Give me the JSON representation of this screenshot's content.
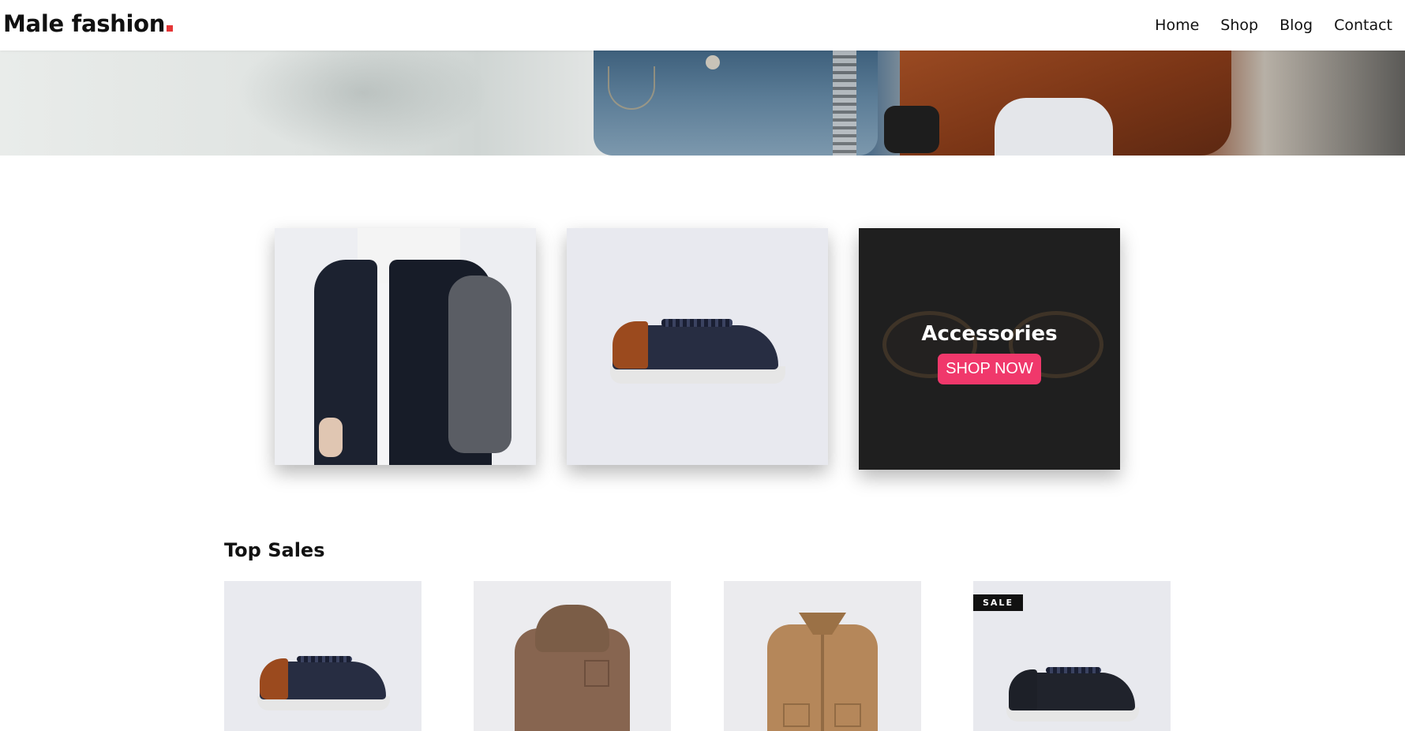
{
  "header": {
    "logo_text": "Male fashion",
    "nav": [
      {
        "label": "Home"
      },
      {
        "label": "Shop"
      },
      {
        "label": "Blog"
      },
      {
        "label": "Contact"
      }
    ]
  },
  "banners": [
    {
      "image": "jacket-photo"
    },
    {
      "image": "sneaker-photo"
    },
    {
      "title": "Accessories",
      "button_label": "SHOP NOW",
      "image": "sunglasses-photo"
    }
  ],
  "top_sales": {
    "title": "Top Sales",
    "products": [
      {
        "image": "sneaker-photo",
        "badge": ""
      },
      {
        "image": "brown-hooded-jacket-photo",
        "badge": ""
      },
      {
        "image": "tan-shirt-jacket-photo",
        "badge": ""
      },
      {
        "image": "navy-sneaker-photo",
        "badge": "SALE"
      }
    ]
  },
  "colors": {
    "accent_red": "#e53637",
    "shop_now_pink": "#f0386b",
    "banner_dark": "#1f1f1f"
  }
}
